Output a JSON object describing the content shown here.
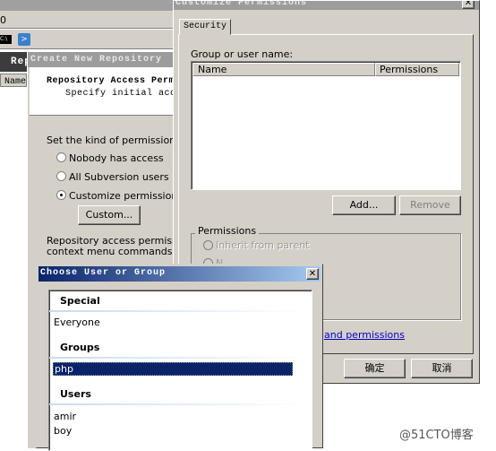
{
  "background_app": {
    "menu_fragment": "0",
    "header_fragment": "Rep",
    "column_name": "Name",
    "icons": [
      "cmd-icon",
      "powershell-icon"
    ]
  },
  "create_repo": {
    "title": "Create New Repository",
    "heading": "Repository Access Perm",
    "subheading": "Specify initial access",
    "prompt": "Set the kind of permissions you",
    "options": [
      {
        "label": "Nobody has access",
        "checked": false
      },
      {
        "label": "All Subversion users have",
        "checked": false
      },
      {
        "label": "Customize permissions",
        "checked": true
      }
    ],
    "custom_button": "Custom...",
    "note_line1": "Repository access permissions c",
    "note_line2": "context menu commands for the"
  },
  "customize": {
    "title": "Customize Permissions",
    "tab": "Security",
    "group_label": "Group or user name:",
    "columns": [
      "Name",
      "Permissions"
    ],
    "add_button": "Add...",
    "remove_button": "Remove",
    "permissions_label": "Permissions",
    "inherit_option": "Inherit from parent",
    "second_option": "N",
    "link": "and permissions",
    "ok_button": "确定",
    "cancel_button": "取消"
  },
  "choose": {
    "title": "Choose User or Group",
    "sections": [
      {
        "header": "Special",
        "items": [
          "Everyone"
        ]
      },
      {
        "header": "Groups",
        "items": [
          "php"
        ]
      },
      {
        "header": "Users",
        "items": [
          "amir",
          "boy"
        ]
      }
    ],
    "selected": "php"
  },
  "watermark": "@51CTO博客",
  "colors": {
    "dialog": "#d4d0c8",
    "selection": "#0a246a",
    "title_start": "#0a246a",
    "title_end": "#a6caf0"
  }
}
